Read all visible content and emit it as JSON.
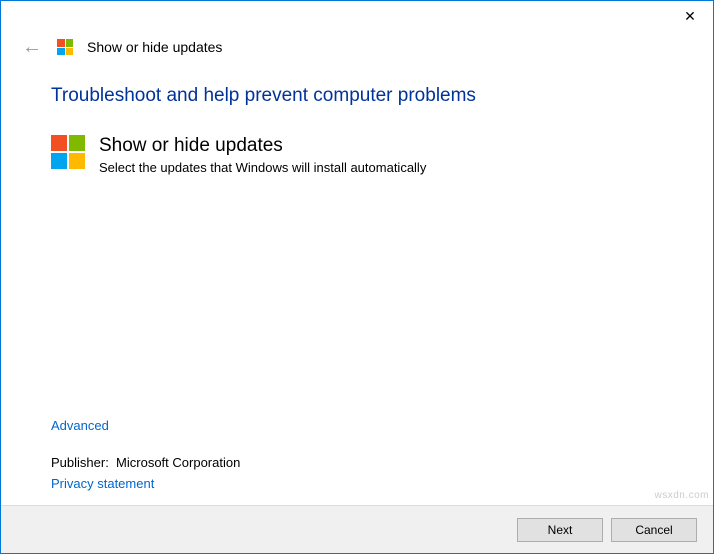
{
  "titlebar": {
    "close_glyph": "✕"
  },
  "header": {
    "back_glyph": "←",
    "title": "Show or hide updates"
  },
  "content": {
    "heading": "Troubleshoot and help prevent computer problems",
    "tool_title": "Show or hide updates",
    "tool_desc": "Select the updates that Windows will install automatically"
  },
  "links": {
    "advanced": "Advanced",
    "privacy": "Privacy statement"
  },
  "publisher": {
    "label": "Publisher:",
    "value": "Microsoft Corporation"
  },
  "buttons": {
    "next": "Next",
    "cancel": "Cancel"
  },
  "watermark": "wsxdn.com"
}
